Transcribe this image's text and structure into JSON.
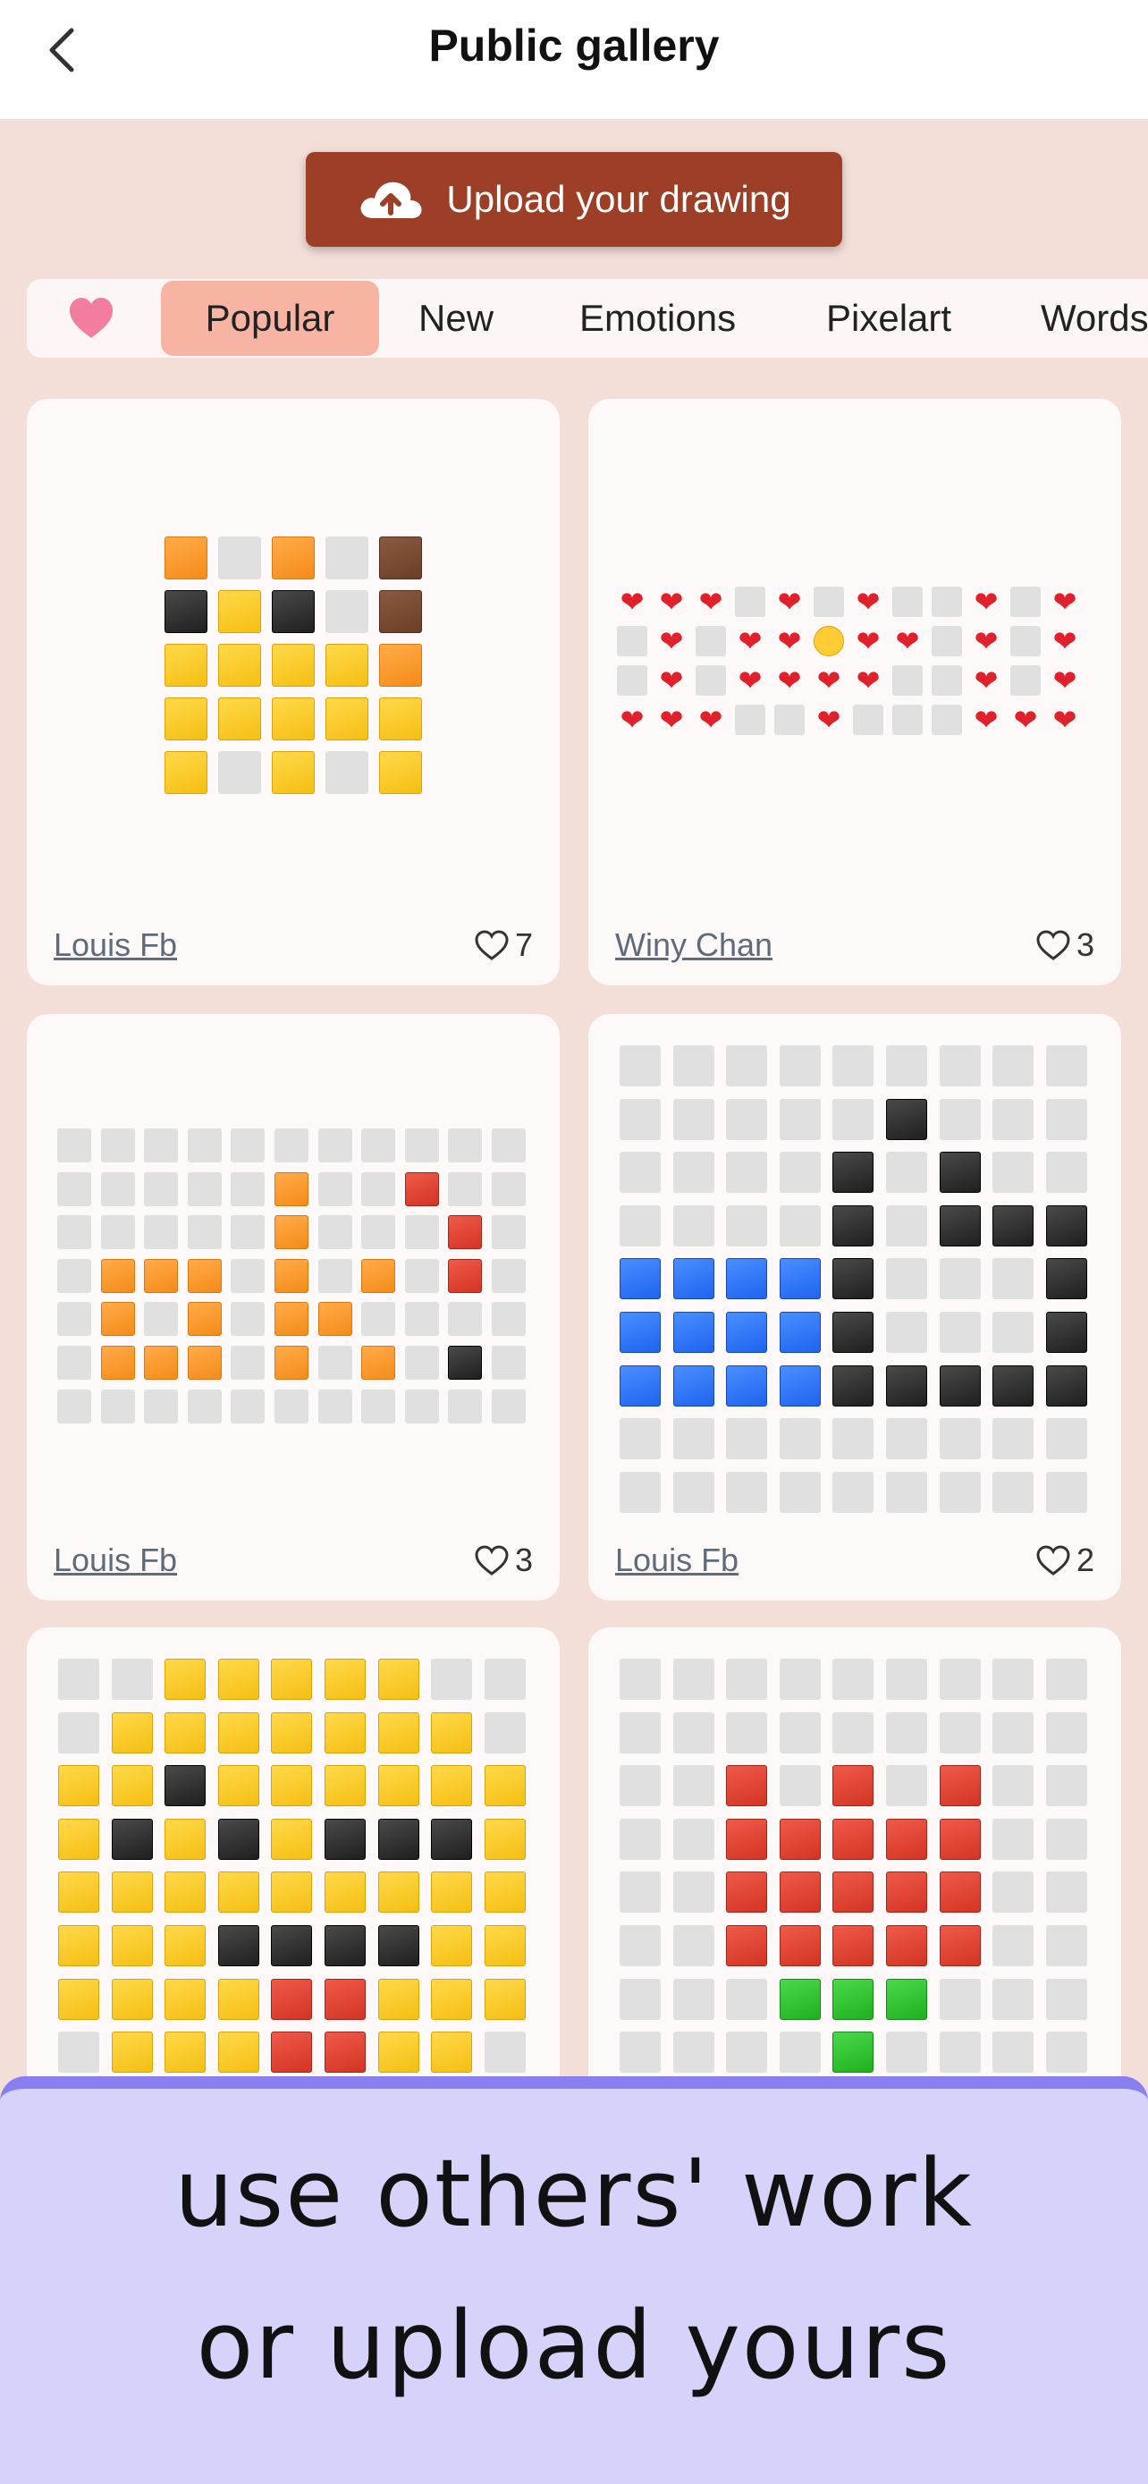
{
  "header": {
    "title": "Public gallery",
    "back_icon": "chevron-left-icon"
  },
  "upload": {
    "label": "Upload your drawing",
    "icon": "cloud-upload-icon"
  },
  "tabs": {
    "favorites_icon": "heart-icon",
    "items": [
      {
        "label": "Popular",
        "active": true
      },
      {
        "label": "New",
        "active": false
      },
      {
        "label": "Emotions",
        "active": false
      },
      {
        "label": "Pixelart",
        "active": false
      },
      {
        "label": "Words",
        "active": false
      }
    ]
  },
  "cards": [
    {
      "author": "Louis Fb",
      "likes": "7",
      "pixels": [
        "ogogb",
        "kykgb",
        "yyyyo",
        "yyyyy",
        "ygygy"
      ]
    },
    {
      "author": "Winy Chan",
      "likes": "3",
      "pixels": [
        "HHHgHgHggHgH",
        "gHgHHWHHgHgH",
        "gHgHHHHggHgH",
        "HHHggHgggHHH"
      ]
    },
    {
      "author": "Louis Fb",
      "likes": "3",
      "pixels": [
        "ggggggggggg",
        "gggggoggrgg",
        "gggggogggrg",
        "gooogogogrg",
        "gogogoogggg",
        "gooogogogkg",
        "ggggggggggg"
      ]
    },
    {
      "author": "Louis Fb",
      "likes": "2",
      "pixels": [
        "ggggggggg",
        "gggggkggg",
        "ggggkgkgg",
        "ggggkgkkk",
        "uuuukgggk",
        "uuuukgggk",
        "uuuukkkkk",
        "ggggggggg",
        "ggggggggg"
      ]
    },
    {
      "author": "",
      "likes": "",
      "pixels": [
        "ggyyyyygg",
        "gyyyyyyyg",
        "yykyyyyyy",
        "ykykykkky",
        "yyyyyyyyy",
        "yyykkkkyy",
        "yyyyrryyy",
        "gyyyrryyg"
      ]
    },
    {
      "author": "",
      "likes": "",
      "pixels": [
        "ggggggggg",
        "ggggggggg",
        "ggrgrgrgg",
        "ggrrrrrgg",
        "ggrrrrrgg",
        "ggrrrrrgg",
        "gggnnnggg",
        "ggggngggg"
      ]
    }
  ],
  "colors": {
    "brand": "#9d3f26",
    "active_tab": "#f7b4a2",
    "banner": "#d6d3fb",
    "banner_border": "#8880f0"
  },
  "banner": {
    "line1": "use others' work",
    "line2": "or upload yours"
  }
}
